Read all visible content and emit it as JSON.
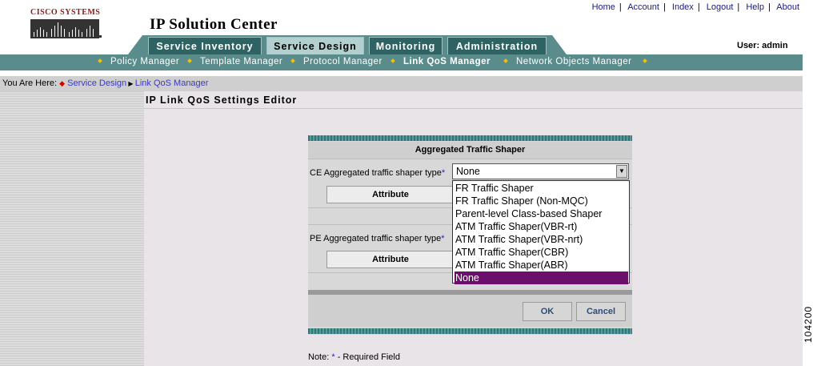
{
  "brand": {
    "company": "Cisco Systems",
    "app_title": "IP Solution Center"
  },
  "top_links": [
    "Home",
    "Account",
    "Index",
    "Logout",
    "Help",
    "About"
  ],
  "user": {
    "label": "User: admin"
  },
  "tabs": [
    {
      "label": "Service Inventory",
      "active": false
    },
    {
      "label": "Service Design",
      "active": true
    },
    {
      "label": "Monitoring",
      "active": false
    },
    {
      "label": "Administration",
      "active": false
    }
  ],
  "subnav": [
    {
      "label": "Policy Manager",
      "active": false
    },
    {
      "label": "Template Manager",
      "active": false
    },
    {
      "label": "Protocol Manager",
      "active": false
    },
    {
      "label": "Link QoS Manager",
      "active": true
    },
    {
      "label": "Network Objects Manager",
      "active": false
    }
  ],
  "breadcrumb": {
    "prefix": "You Are Here:",
    "items": [
      "Service Design",
      "Link QoS Manager"
    ]
  },
  "page_title": "IP Link QoS Settings Editor",
  "form": {
    "header": "Aggregated Traffic Shaper",
    "ce_label": "CE Aggregated traffic shaper type",
    "pe_label": "PE Aggregated traffic shaper type",
    "required_mark": "*",
    "attribute_label": "Attribute",
    "select_value": "None",
    "options": [
      "FR Traffic Shaper",
      "FR Traffic Shaper (Non-MQC)",
      "Parent-level Class-based Shaper",
      "ATM Traffic Shaper(VBR-rt)",
      "ATM Traffic Shaper(VBR-nrt)",
      "ATM Traffic Shaper(CBR)",
      "ATM Traffic Shaper(ABR)",
      "None"
    ],
    "ok_label": "OK",
    "cancel_label": "Cancel"
  },
  "note": {
    "prefix": "Note:",
    "mark": "*",
    "text": "- Required Field"
  },
  "figure_number": "104200",
  "colors": {
    "teal": "#5b8c8c",
    "dark_teal": "#2f6262",
    "selected_option": "#6c0f6c",
    "required": "#2323c0"
  }
}
